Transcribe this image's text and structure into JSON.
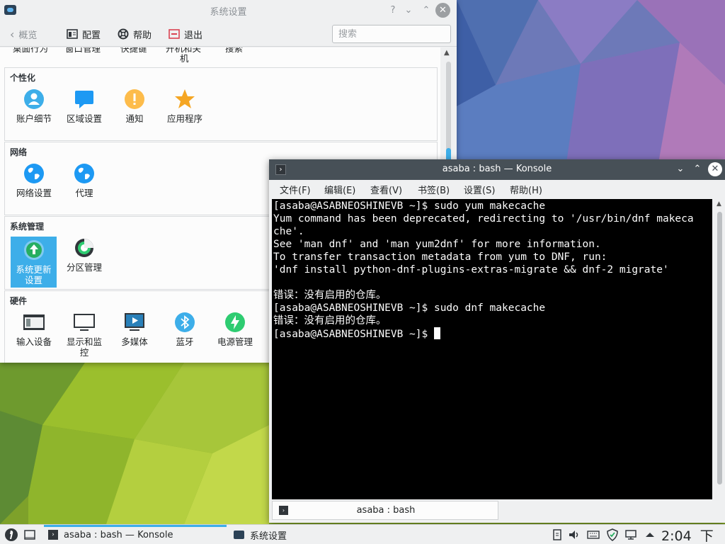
{
  "settings_window": {
    "title": "系统设置",
    "help_button": "?",
    "min_button": "⌄",
    "max_button": "⌃",
    "close_button": "✕",
    "toolbar": {
      "back_label": "概览",
      "configure_label": "配置",
      "help_label": "帮助",
      "quit_label": "退出",
      "search_placeholder": "搜索"
    },
    "partial_top_labels": [
      "桌面行为",
      "窗口管理",
      "快捷键",
      "开机和关",
      "机",
      "搜索"
    ],
    "sections": [
      {
        "title": "个性化",
        "items": [
          {
            "label": "账户细节",
            "icon": "user-icon"
          },
          {
            "label": "区域设置",
            "icon": "chat-icon"
          },
          {
            "label": "通知",
            "icon": "warning-icon"
          },
          {
            "label": "应用程序",
            "icon": "star-icon"
          }
        ]
      },
      {
        "title": "网络",
        "items": [
          {
            "label": "网络设置",
            "icon": "globe-icon"
          },
          {
            "label": "代理",
            "icon": "globe-icon"
          }
        ]
      },
      {
        "title": "系统管理",
        "items": [
          {
            "label": "系统更新设置",
            "label_line1": "系统更新",
            "label_line2": "设置",
            "icon": "update-icon",
            "selected": true
          },
          {
            "label": "分区管理",
            "icon": "partition-icon"
          }
        ]
      },
      {
        "title": "硬件",
        "items": [
          {
            "label": "输入设备",
            "icon": "keyboard-icon"
          },
          {
            "label": "显示和监控",
            "label_line1": "显示和监",
            "label_line2": "控",
            "icon": "monitor-icon"
          },
          {
            "label": "多媒体",
            "icon": "multimedia-icon"
          },
          {
            "label": "蓝牙",
            "icon": "bluetooth-icon"
          },
          {
            "label": "电源管理",
            "icon": "power-icon"
          }
        ]
      }
    ]
  },
  "konsole_window": {
    "title": "asaba : bash — Konsole",
    "menu": [
      "文件(F)",
      "编辑(E)",
      "查看(V)",
      "书签(B)",
      "设置(S)",
      "帮助(H)"
    ],
    "terminal_lines": [
      "[asaba@ASABNEOSHINEVB ~]$ sudo yum makecache",
      "Yum command has been deprecated, redirecting to '/usr/bin/dnf makeca",
      "che'.",
      "See 'man dnf' and 'man yum2dnf' for more information.",
      "To transfer transaction metadata from yum to DNF, run:",
      "'dnf install python-dnf-plugins-extras-migrate && dnf-2 migrate'",
      "",
      "错误：没有启用的仓库。",
      "[asaba@ASABNEOSHINEVB ~]$ sudo dnf makecache",
      "错误：没有启用的仓库。",
      "[asaba@ASABNEOSHINEVB ~]$ "
    ],
    "tab_label": "asaba : bash"
  },
  "taskbar": {
    "tasks": [
      {
        "label": "asaba : bash — Konsole",
        "active": true
      },
      {
        "label": "系统设置",
        "active": false
      }
    ],
    "clock_time": "2:04",
    "clock_suffix": "下午"
  },
  "colors": {
    "accent": "#3daee9",
    "terminal_bg": "#000000",
    "konsole_titlebar": "#475057"
  }
}
